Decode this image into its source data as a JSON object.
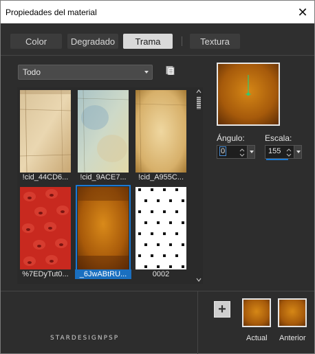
{
  "window": {
    "title": "Propiedades del material",
    "close_glyph": "✕"
  },
  "tabs": [
    {
      "label": "Color",
      "active": false
    },
    {
      "label": "Degradado",
      "active": false
    },
    {
      "label": "Trama",
      "active": true
    },
    {
      "label": "Textura",
      "active": false
    }
  ],
  "category": {
    "selected": "Todo"
  },
  "patterns": [
    {
      "label": "!cid_44CD6...",
      "style": "parchment"
    },
    {
      "label": "!cid_9ACE7...",
      "style": "bluepaper"
    },
    {
      "label": "!cid_A955C...",
      "style": "oldpaper"
    },
    {
      "label": "%7EDyTut0...",
      "style": "strawberry"
    },
    {
      "label": "_6JwABtRU...",
      "style": "orangebrown",
      "selected": true
    },
    {
      "label": "0002",
      "style": "dots"
    }
  ],
  "angle": {
    "label": "Ángulo:",
    "value": "0"
  },
  "scale": {
    "label": "Escala:",
    "value": "155"
  },
  "footer": {
    "watermark": "STARDESIGNPSP",
    "add_glyph": "+",
    "current_label": "Actual",
    "previous_label": "Anterior"
  },
  "colors": {
    "accent": "#1a7ad6",
    "preview_orange": "#b86a0a",
    "angle_line": "#2ecc71"
  }
}
